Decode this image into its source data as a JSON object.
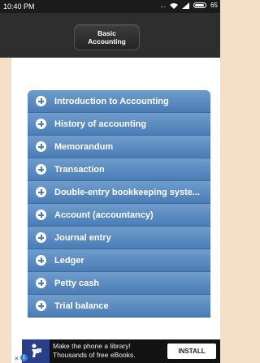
{
  "status_bar": {
    "time": "10:40 PM",
    "dots": "...",
    "battery_percent": "65"
  },
  "header": {
    "title_line1": "Basic",
    "title_line2": "Accounting"
  },
  "topics": [
    {
      "label": "Introduction to Accounting"
    },
    {
      "label": "History of accounting"
    },
    {
      "label": "Memorandum"
    },
    {
      "label": "Transaction"
    },
    {
      "label": "Double-entry bookkeeping syste..."
    },
    {
      "label": "Account (accountancy)"
    },
    {
      "label": "Journal entry"
    },
    {
      "label": "Ledger"
    },
    {
      "label": "Petty cash"
    },
    {
      "label": "Trial balance"
    }
  ],
  "ad": {
    "line1": "Make the phone a library!",
    "line2": "Thousands of free eBooks.",
    "install_label": "INSTALL"
  },
  "colors": {
    "item_gradient_top": "#6f9ccb",
    "item_gradient_bottom": "#4a7db6",
    "header_bg": "#2e2e2e",
    "frame_bg": "#f6dfc7"
  }
}
